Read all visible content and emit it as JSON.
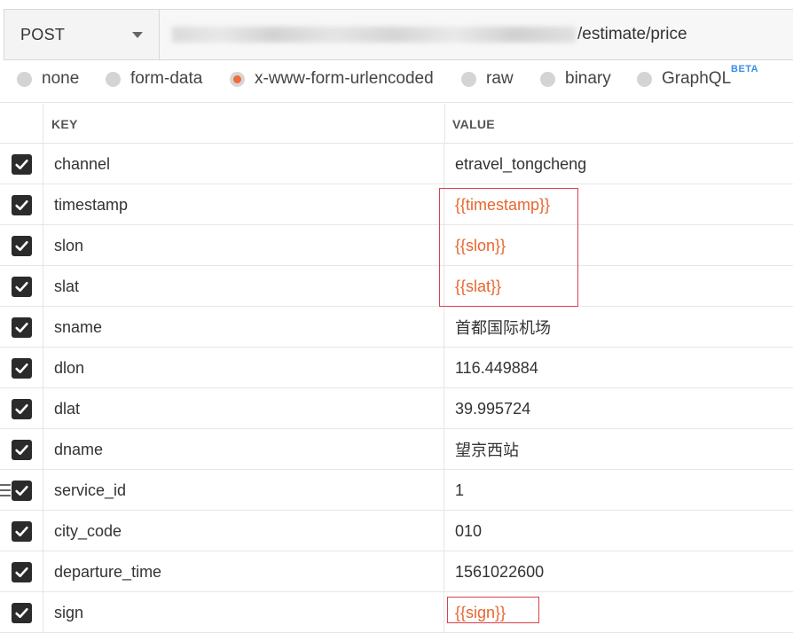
{
  "request": {
    "method": "POST",
    "url_visible": "/estimate/price"
  },
  "body_types": {
    "options": [
      "none",
      "form-data",
      "x-www-form-urlencoded",
      "raw",
      "binary",
      "GraphQL"
    ],
    "selected": "x-www-form-urlencoded",
    "badge": "BETA"
  },
  "table": {
    "headers": {
      "key": "KEY",
      "value": "VALUE"
    },
    "rows": [
      {
        "key": "channel",
        "value": "etravel_tongcheng",
        "checked": true,
        "variable": false
      },
      {
        "key": "timestamp",
        "value": "{{timestamp}}",
        "checked": true,
        "variable": true
      },
      {
        "key": "slon",
        "value": "{{slon}}",
        "checked": true,
        "variable": true
      },
      {
        "key": "slat",
        "value": "{{slat}}",
        "checked": true,
        "variable": true
      },
      {
        "key": "sname",
        "value": "首都国际机场",
        "checked": true,
        "variable": false
      },
      {
        "key": "dlon",
        "value": "116.449884",
        "checked": true,
        "variable": false
      },
      {
        "key": "dlat",
        "value": "39.995724",
        "checked": true,
        "variable": false
      },
      {
        "key": "dname",
        "value": "望京西站",
        "checked": true,
        "variable": false
      },
      {
        "key": "service_id",
        "value": "1",
        "checked": true,
        "variable": false
      },
      {
        "key": "city_code",
        "value": "010",
        "checked": true,
        "variable": false
      },
      {
        "key": "departure_time",
        "value": "1561022600",
        "checked": true,
        "variable": false
      },
      {
        "key": "sign",
        "value": "{{sign}}",
        "checked": true,
        "variable": true
      }
    ]
  },
  "colors": {
    "variable_text": "#e8652e",
    "radio_selected": "#f26b3a",
    "highlight_border": "#d9424a",
    "checkbox_bg": "#2b2b2b"
  }
}
